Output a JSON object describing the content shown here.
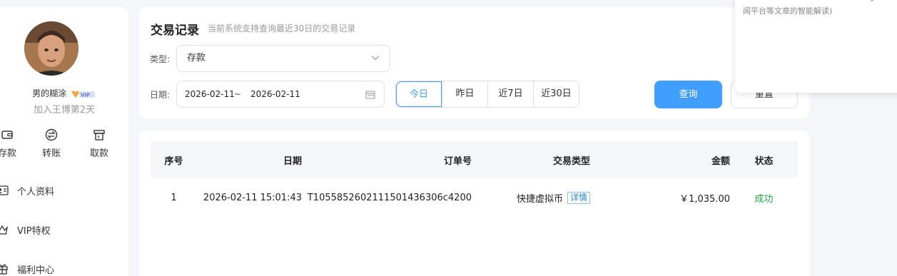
{
  "user": {
    "name": "男的糊涂",
    "vip_badge": "VIP",
    "joined": "加入王博第2天"
  },
  "quick_actions": [
    {
      "label": "存款",
      "icon": "wallet-icon"
    },
    {
      "label": "转账",
      "icon": "transfer-icon"
    },
    {
      "label": "取款",
      "icon": "withdraw-icon"
    }
  ],
  "menu": [
    {
      "label": "个人资料",
      "icon": "id-card-icon"
    },
    {
      "label": "VIP特权",
      "icon": "crown-icon"
    },
    {
      "label": "福利中心",
      "icon": "gift-icon"
    }
  ],
  "search": {
    "title": "交易记录",
    "subtitle": "当前系统支持查询最近30日的交易记录",
    "type_label": "类型:",
    "type_value": "存款",
    "date_label": "日期:",
    "date_start": "2026-02-11",
    "date_sep": "~",
    "date_end": "2026-02-11",
    "ranges": [
      "今日",
      "昨日",
      "近7日",
      "近30日"
    ],
    "active_range": "今日",
    "query_label": "查询",
    "reset_label": "重置"
  },
  "table": {
    "columns": [
      "序号",
      "日期",
      "订单号",
      "交易类型",
      "金额",
      "状态"
    ],
    "rows": [
      {
        "seq": "1",
        "date": "2026-02-11 15:01:43",
        "order": "T1055852602111501436306c4200",
        "type": "快捷虚拟币",
        "detail": "详情",
        "amount": "￥1,035.00",
        "status": "成功"
      }
    ]
  },
  "popup": {
    "text": "闻平台等文章的智能解读)"
  },
  "colors": {
    "accent": "#409eff",
    "success": "#27a64a"
  }
}
